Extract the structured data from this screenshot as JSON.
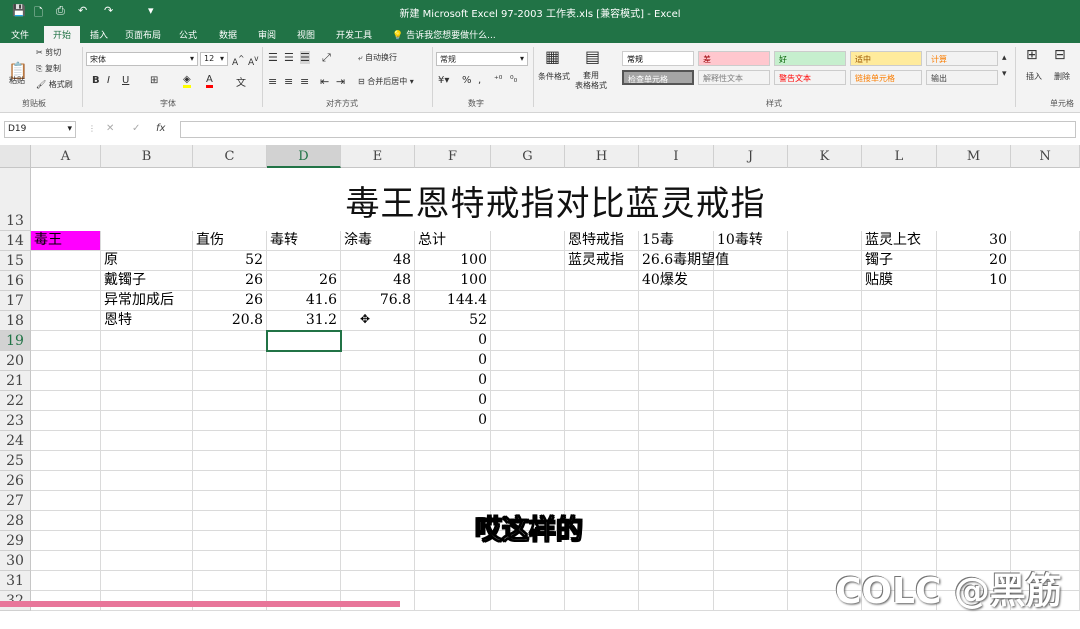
{
  "titlebar": {
    "title": "新建 Microsoft Excel 97-2003 工作表.xls  [兼容模式] - Excel",
    "quick_access": [
      "💾",
      "🗋",
      "⎙",
      "↶",
      "↷",
      "▾"
    ]
  },
  "tabs": [
    "文件",
    "开始",
    "插入",
    "页面布局",
    "公式",
    "数据",
    "审阅",
    "视图",
    "开发工具"
  ],
  "tell_me": "告诉我您想要做什么...",
  "ribbon": {
    "clipboard": {
      "paste": "粘贴",
      "cut": "剪切",
      "copy": "复制",
      "format_painter": "格式刷",
      "label": "剪贴板"
    },
    "font": {
      "name": "宋体",
      "size": "12",
      "label": "字体",
      "bold": "B",
      "italic": "I",
      "underline": "U"
    },
    "alignment": {
      "wrap": "自动换行",
      "merge": "合并后居中",
      "label": "对齐方式"
    },
    "number": {
      "format": "常规",
      "label": "数字",
      "percent": "%",
      "comma": ","
    },
    "styles": {
      "cond_format": "条件格式",
      "table_format": "套用\n表格格式",
      "label": "样式",
      "cells": [
        {
          "text": "常规",
          "bg": "#ffffff",
          "color": "#000000"
        },
        {
          "text": "差",
          "bg": "#ffc7ce",
          "color": "#9c0006"
        },
        {
          "text": "好",
          "bg": "#c6efce",
          "color": "#006100"
        },
        {
          "text": "适中",
          "bg": "#ffeb9c",
          "color": "#9c5700"
        },
        {
          "text": "计算",
          "bg": "#f2f2f2",
          "color": "#fa7d00"
        },
        {
          "text": "检查单元格",
          "bg": "#a5a5a5",
          "color": "#ffffff"
        },
        {
          "text": "解释性文本",
          "bg": "#f3f3f3",
          "color": "#7f7f7f"
        },
        {
          "text": "警告文本",
          "bg": "#f3f3f3",
          "color": "#ff0000"
        },
        {
          "text": "链接单元格",
          "bg": "#f3f3f3",
          "color": "#fa7d00"
        },
        {
          "text": "输出",
          "bg": "#f2f2f2",
          "color": "#3f3f3f"
        }
      ]
    },
    "cells_group": {
      "insert": "插入",
      "delete": "删除",
      "label": "单元格"
    }
  },
  "formula_bar": {
    "name_box": "D19",
    "fx": "fx",
    "cancel": "✕",
    "enter": "✓"
  },
  "columns": [
    "A",
    "B",
    "C",
    "D",
    "E",
    "F",
    "G",
    "H",
    "I",
    "J",
    "K",
    "L",
    "M",
    "N"
  ],
  "rows": [
    "13",
    "14",
    "15",
    "16",
    "17",
    "18",
    "19",
    "20",
    "21",
    "22",
    "23",
    "24",
    "25",
    "26",
    "27",
    "28",
    "29",
    "30",
    "31",
    "32"
  ],
  "sheet_title": "毒王恩特戒指对比蓝灵戒指",
  "cells": [
    {
      "ref": "A14",
      "text": "毒王",
      "bg": "#ff00ff"
    },
    {
      "ref": "C14",
      "text": "直伤"
    },
    {
      "ref": "D14",
      "text": "毒转"
    },
    {
      "ref": "E14",
      "text": "涂毒"
    },
    {
      "ref": "F14",
      "text": "总计"
    },
    {
      "ref": "B15",
      "text": "原"
    },
    {
      "ref": "C15",
      "text": "52",
      "num": true
    },
    {
      "ref": "E15",
      "text": "48",
      "num": true
    },
    {
      "ref": "F15",
      "text": "100",
      "num": true
    },
    {
      "ref": "B16",
      "text": "戴镯子"
    },
    {
      "ref": "C16",
      "text": "26",
      "num": true
    },
    {
      "ref": "D16",
      "text": "26",
      "num": true
    },
    {
      "ref": "E16",
      "text": "48",
      "num": true
    },
    {
      "ref": "F16",
      "text": "100",
      "num": true
    },
    {
      "ref": "B17",
      "text": "异常加成后"
    },
    {
      "ref": "C17",
      "text": "26",
      "num": true
    },
    {
      "ref": "D17",
      "text": "41.6",
      "num": true
    },
    {
      "ref": "E17",
      "text": "76.8",
      "num": true
    },
    {
      "ref": "F17",
      "text": "144.4",
      "num": true
    },
    {
      "ref": "B18",
      "text": "恩特"
    },
    {
      "ref": "C18",
      "text": "20.8",
      "num": true
    },
    {
      "ref": "D18",
      "text": "31.2",
      "num": true
    },
    {
      "ref": "F18",
      "text": "52",
      "num": true
    },
    {
      "ref": "F19",
      "text": "0",
      "num": true
    },
    {
      "ref": "F20",
      "text": "0",
      "num": true
    },
    {
      "ref": "F21",
      "text": "0",
      "num": true
    },
    {
      "ref": "F22",
      "text": "0",
      "num": true
    },
    {
      "ref": "F23",
      "text": "0",
      "num": true
    },
    {
      "ref": "H14",
      "text": "恩特戒指"
    },
    {
      "ref": "I14",
      "text": "15毒"
    },
    {
      "ref": "J14",
      "text": "10毒转"
    },
    {
      "ref": "H15",
      "text": "蓝灵戒指"
    },
    {
      "ref": "I15",
      "text": "26.6毒期望值"
    },
    {
      "ref": "I16",
      "text": "40爆发"
    },
    {
      "ref": "L14",
      "text": "蓝灵上衣"
    },
    {
      "ref": "M14",
      "text": "30",
      "num": true
    },
    {
      "ref": "L15",
      "text": "镯子"
    },
    {
      "ref": "M15",
      "text": "20",
      "num": true
    },
    {
      "ref": "L16",
      "text": "贴膜"
    },
    {
      "ref": "M16",
      "text": "10",
      "num": true
    }
  ],
  "selected_cell": "D19",
  "subtitle_caption": "哎这样的",
  "watermark": "COLC @黑筋",
  "video_progress": 0.37
}
